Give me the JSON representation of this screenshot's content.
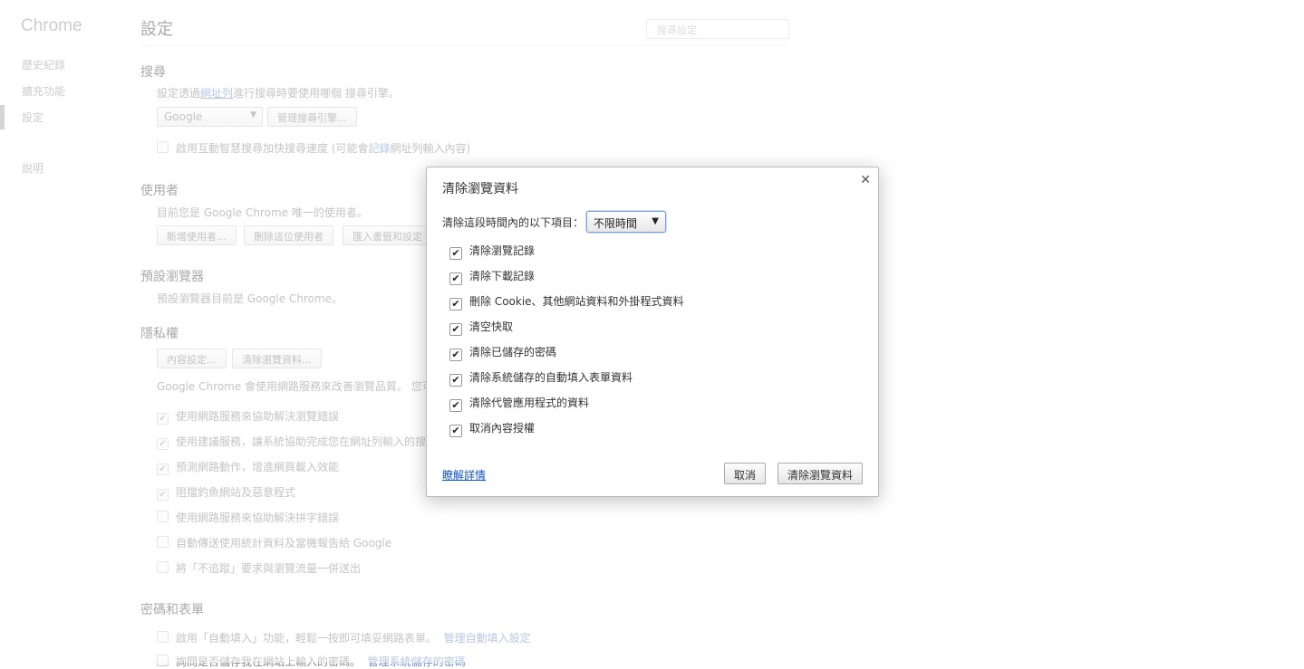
{
  "sidebar": {
    "brand": "Chrome",
    "items": [
      {
        "label": "歷史紀錄"
      },
      {
        "label": "擴充功能"
      },
      {
        "label": "設定"
      },
      {
        "label": "說明"
      }
    ]
  },
  "header": {
    "title": "設定",
    "search_placeholder": "搜尋設定"
  },
  "search_section": {
    "heading": "搜尋",
    "desc_prefix": "設定透過",
    "desc_link": "網址列",
    "desc_suffix": "進行搜尋時要使用哪個 搜尋引擎。",
    "engine_value": "Google",
    "manage_button": "管理搜尋引擎...",
    "instant_prefix": "啟用互動智慧搜尋加快搜尋速度 (可能會",
    "instant_link": "記錄",
    "instant_suffix": "網址列輸入內容)"
  },
  "users_section": {
    "heading": "使用者",
    "desc": "目前您是 Google Chrome 唯一的使用者。",
    "add_button": "新增使用者...",
    "remove_button": "刪除這位使用者",
    "import_button": "匯入書籤和設定"
  },
  "default_browser": {
    "heading": "預設瀏覽器",
    "desc": "預設瀏覽器目前是 Google Chrome。"
  },
  "privacy": {
    "heading": "隱私權",
    "content_button": "內容設定...",
    "clear_button": "清除瀏覽資料...",
    "desc": "Google Chrome 會使用網路服務來改善瀏覽品質。 您可",
    "options": [
      {
        "label": "使用網路服務來協助解決瀏覽錯誤",
        "checked": true
      },
      {
        "label": "使用建議服務，讓系統協助完成您在網址列輸入的搜",
        "checked": true
      },
      {
        "label": "預測網路動作，增進網頁載入效能",
        "checked": true
      },
      {
        "label": "阻擋釣魚網站及惡意程式",
        "checked": true
      },
      {
        "label": "使用網路服務來協助解決拼字錯誤",
        "checked": false
      },
      {
        "label": "自動傳送使用統計資料及當機報告給 Google",
        "checked": false
      },
      {
        "label": "將「不追蹤」要求與瀏覽流量一併送出",
        "checked": false
      }
    ]
  },
  "passwords": {
    "heading": "密碼和表單",
    "autofill_label": "啟用「自動填入」功能，輕鬆一按即可填妥網路表單。",
    "autofill_link": "管理自動填入設定",
    "save_label": "詢問是否儲存我在網站上輸入的密碼。",
    "save_link": "管理系統儲存的密碼"
  },
  "dialog": {
    "title": "清除瀏覽資料",
    "period_label": "清除這段時間內的以下項目：",
    "period_value": "不限時間",
    "items": [
      {
        "label": "清除瀏覽記錄",
        "checked": true
      },
      {
        "label": "清除下載記錄",
        "checked": true
      },
      {
        "label": "刪除 Cookie、其他網站資料和外掛程式資料",
        "checked": true
      },
      {
        "label": "清空快取",
        "checked": true
      },
      {
        "label": "清除已儲存的密碼",
        "checked": true
      },
      {
        "label": "清除系統儲存的自動填入表單資料",
        "checked": true
      },
      {
        "label": "清除代管應用程式的資料",
        "checked": true
      },
      {
        "label": "取消內容授權",
        "checked": true
      }
    ],
    "learn_more": "瞭解詳情",
    "cancel_button": "取消",
    "confirm_button": "清除瀏覽資料"
  }
}
